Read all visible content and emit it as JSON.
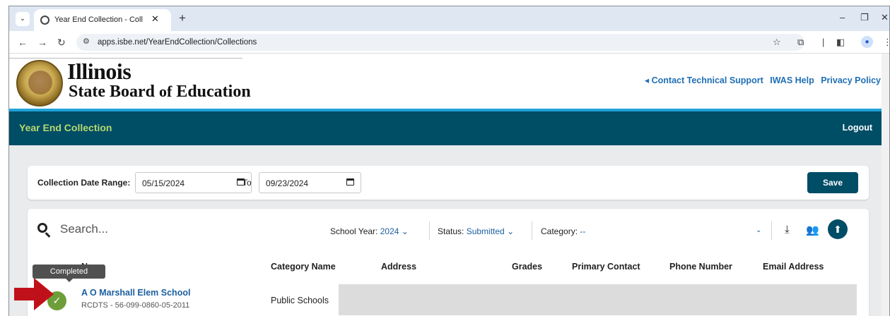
{
  "browser": {
    "tab_title": "Year End Collection - Collection",
    "url": "apps.isbe.net/YearEndCollection/Collections"
  },
  "header": {
    "logo_line1": "Illinois",
    "logo_line2_a": "State Board",
    "logo_line2_b": "of",
    "logo_line2_c": "Education",
    "links": {
      "contact": "◂ Contact Technical Support",
      "iwas": "IWAS Help",
      "privacy": "Privacy Policy"
    }
  },
  "appbar": {
    "title": "Year End Collection",
    "logout": "Logout"
  },
  "date_range": {
    "label": "Collection Date Range:",
    "start": "05/15/2024",
    "to": "To",
    "end": "09/23/2024",
    "save": "Save"
  },
  "toolbar": {
    "search_placeholder": "Search...",
    "school_year_label": "School Year:",
    "school_year_value": "2024",
    "status_label": "Status:",
    "status_value": "Submitted",
    "category_label": "Category:",
    "category_value": "--"
  },
  "table": {
    "headers": {
      "name": "Name",
      "category": "Category Name",
      "address": "Address",
      "grades": "Grades",
      "contact": "Primary Contact",
      "phone": "Phone Number",
      "email": "Email Address"
    },
    "rows": [
      {
        "name": "A O Marshall Elem School",
        "rcdts": "RCDTS - 56-099-0860-05-2011",
        "category": "Public Schools",
        "status": "Completed"
      }
    ]
  },
  "tooltip": "Completed",
  "colors": {
    "brand_dark": "#004d66",
    "accent": "#21a3d8",
    "app_title": "#b5d96e",
    "link": "#1f6fb5",
    "completed": "#6e9e3a",
    "arrow": "#c0111a"
  }
}
